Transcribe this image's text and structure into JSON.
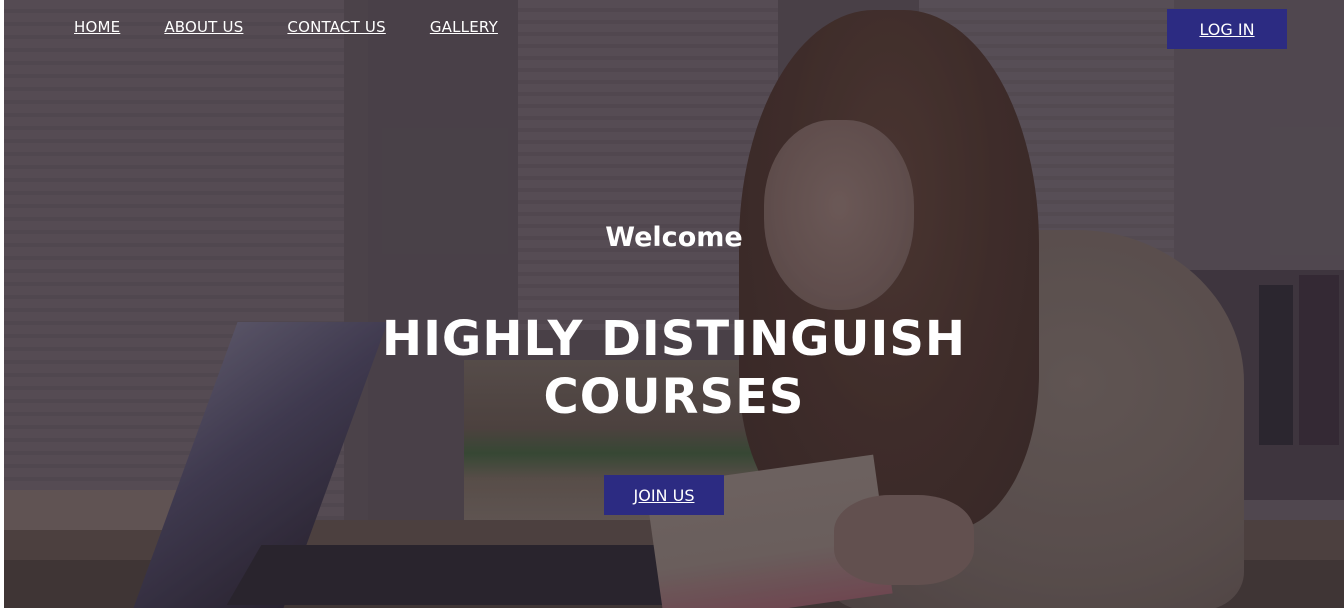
{
  "nav": {
    "items": [
      {
        "label": "HOME"
      },
      {
        "label": "ABOUT US"
      },
      {
        "label": "CONTACT US"
      },
      {
        "label": "GALLERY"
      }
    ],
    "login_label": "LOG IN"
  },
  "hero": {
    "welcome": "Welcome",
    "headline_line1": "HIGHLY DISTINGUISH",
    "headline_line2": "COURSES",
    "cta_label": "JOIN US",
    "background_image": "student-reading-at-desk-photo"
  },
  "colors": {
    "button_bg": "#2c2b82",
    "text": "#ffffff"
  }
}
